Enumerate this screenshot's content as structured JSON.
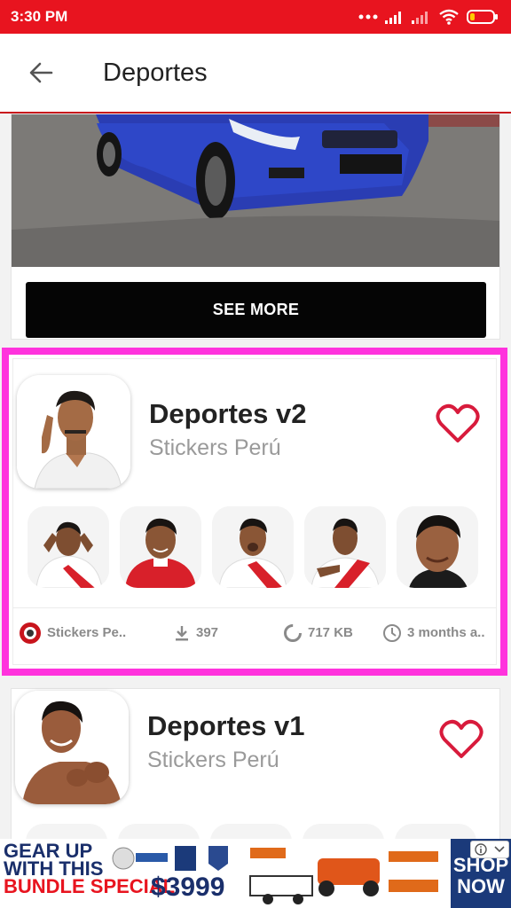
{
  "status_bar": {
    "time": "3:30 PM"
  },
  "app_bar": {
    "title": "Deportes"
  },
  "ad_card": {
    "see_more_label": "SEE MORE"
  },
  "packs": [
    {
      "title": "Deportes v2",
      "author": "Stickers Perú",
      "author_short": "Stickers Pe..",
      "downloads": "397",
      "size": "717 KB",
      "updated": "3 months a.."
    },
    {
      "title": "Deportes v1",
      "author": "Stickers Perú"
    }
  ],
  "bottom_ad": {
    "line1": "GEAR UP",
    "line2": "WITH THIS",
    "line3": "BUNDLE SPECIAL",
    "price": "$3999",
    "cta": "SHOP NOW"
  },
  "colors": {
    "status_bar": "#e8141f",
    "highlight": "#ff33dd",
    "heart": "#d81b3c"
  }
}
